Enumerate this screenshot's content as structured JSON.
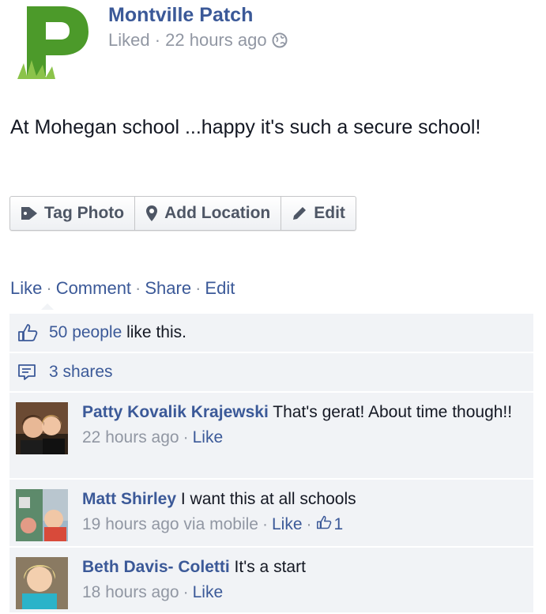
{
  "post": {
    "page_name": "Montville Patch",
    "meta": "Liked · 22 hours ago",
    "caption": "At Mohegan school ...happy it's such a secure school!"
  },
  "photo_actions": {
    "tag_photo": "Tag Photo",
    "add_location": "Add Location",
    "edit": "Edit"
  },
  "actions": {
    "like": "Like",
    "comment": "Comment",
    "share": "Share",
    "edit": "Edit",
    "separator": "·"
  },
  "ufi": {
    "likes_count": "50 people",
    "likes_suffix": " like this.",
    "shares": "3 shares"
  },
  "comments": [
    {
      "author": "Patty Kovalik Krajewski",
      "text": " That's gerat! About time though!!",
      "time": "22 hours ago",
      "like": "Like"
    },
    {
      "author": "Matt Shirley",
      "text": " I want this at all schools",
      "time": "19 hours ago via mobile",
      "like": "Like",
      "like_count": "1"
    },
    {
      "author": "Beth Davis- Coletti",
      "text": " It's a start",
      "time": "18 hours ago",
      "like": "Like"
    }
  ],
  "colors": {
    "link": "#3b5998",
    "meta": "#9197a3",
    "logo_green": "#4c9a2a",
    "ufi_bg": "#f1f3f6"
  }
}
